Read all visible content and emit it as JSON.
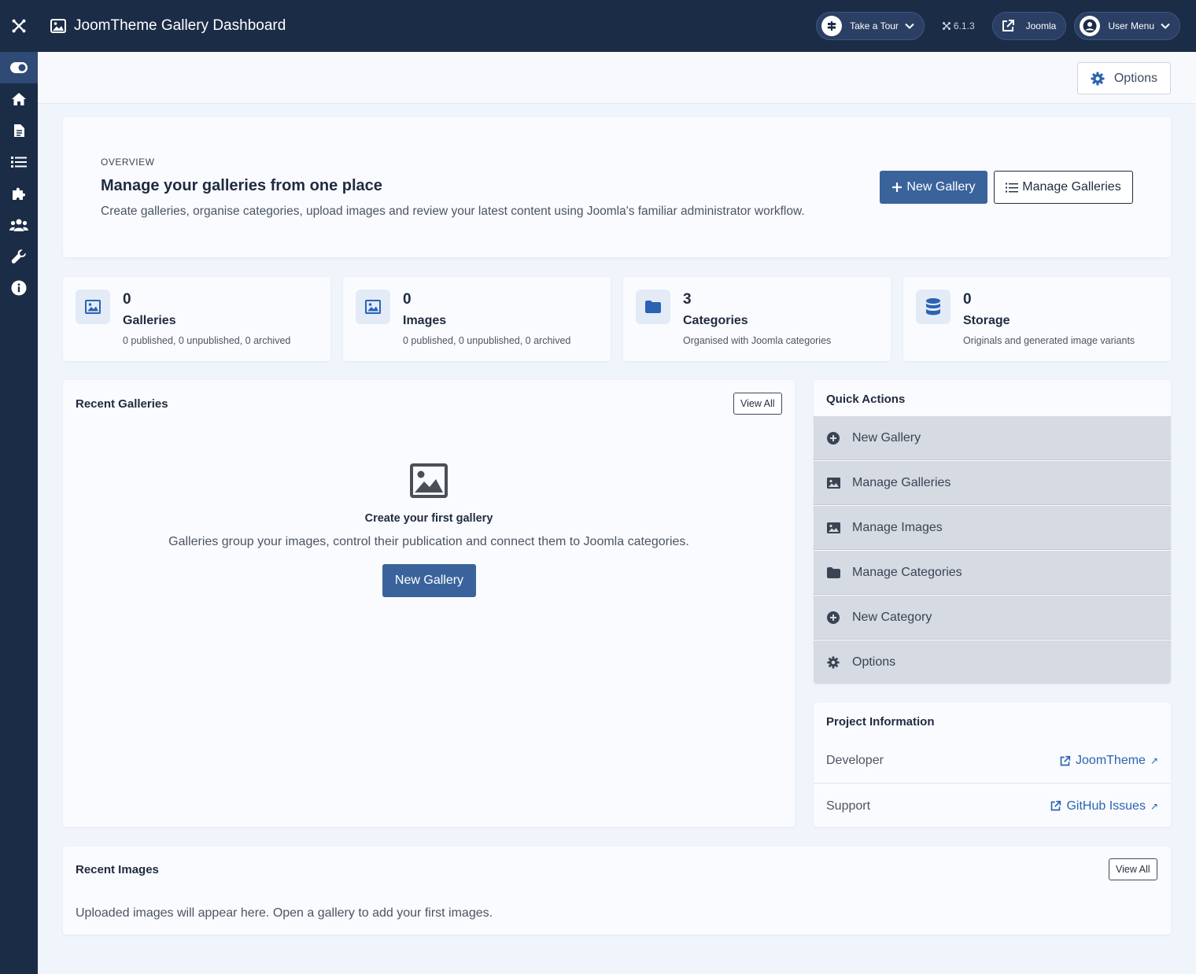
{
  "header": {
    "title": "JoomTheme Gallery Dashboard",
    "tour_label": "Take a Tour",
    "version": "6.1.3",
    "joomla_label": "Joomla",
    "user_menu_label": "User Menu"
  },
  "sidebar": {
    "items": [
      "toggle-menu",
      "home",
      "content",
      "menus",
      "components",
      "users",
      "system",
      "help"
    ]
  },
  "toolbar": {
    "options_label": "Options"
  },
  "overview": {
    "eyebrow": "OVERVIEW",
    "title": "Manage your galleries from one place",
    "description": "Create galleries, organise categories, upload images and review your latest content using Joomla's familiar administrator workflow.",
    "new_gallery_label": "New Gallery",
    "manage_galleries_label": "Manage Galleries"
  },
  "stats": [
    {
      "value": "0",
      "label": "Galleries",
      "sub": "0 published, 0 unpublished, 0 archived",
      "icon": "image-icon"
    },
    {
      "value": "0",
      "label": "Images",
      "sub": "0 published, 0 unpublished, 0 archived",
      "icon": "image-icon"
    },
    {
      "value": "3",
      "label": "Categories",
      "sub": "Organised with Joomla categories",
      "icon": "folder-icon"
    },
    {
      "value": "0",
      "label": "Storage",
      "sub": "Originals and generated image variants",
      "icon": "database-icon"
    }
  ],
  "recent_galleries": {
    "title": "Recent Galleries",
    "view_all": "View All",
    "empty_title": "Create your first gallery",
    "empty_desc": "Galleries group your images, control their publication and connect them to Joomla categories.",
    "new_gallery_label": "New Gallery"
  },
  "quick_actions": {
    "title": "Quick Actions",
    "items": [
      {
        "label": "New Gallery",
        "icon": "plus-circle-icon"
      },
      {
        "label": "Manage Galleries",
        "icon": "image-icon"
      },
      {
        "label": "Manage Images",
        "icon": "image-icon"
      },
      {
        "label": "Manage Categories",
        "icon": "folder-icon"
      },
      {
        "label": "New Category",
        "icon": "plus-circle-icon"
      },
      {
        "label": "Options",
        "icon": "gear-icon"
      }
    ]
  },
  "project_info": {
    "title": "Project Information",
    "rows": [
      {
        "label": "Developer",
        "link": "JoomTheme"
      },
      {
        "label": "Support",
        "link": "GitHub Issues"
      }
    ]
  },
  "recent_images": {
    "title": "Recent Images",
    "view_all": "View All",
    "empty_desc": "Uploaded images will appear here. Open a gallery to add your first images."
  },
  "colors": {
    "navy": "#1b2c47",
    "primary": "#3a639c",
    "link": "#2a63b3",
    "quick_action_bg": "#d5dae3"
  }
}
